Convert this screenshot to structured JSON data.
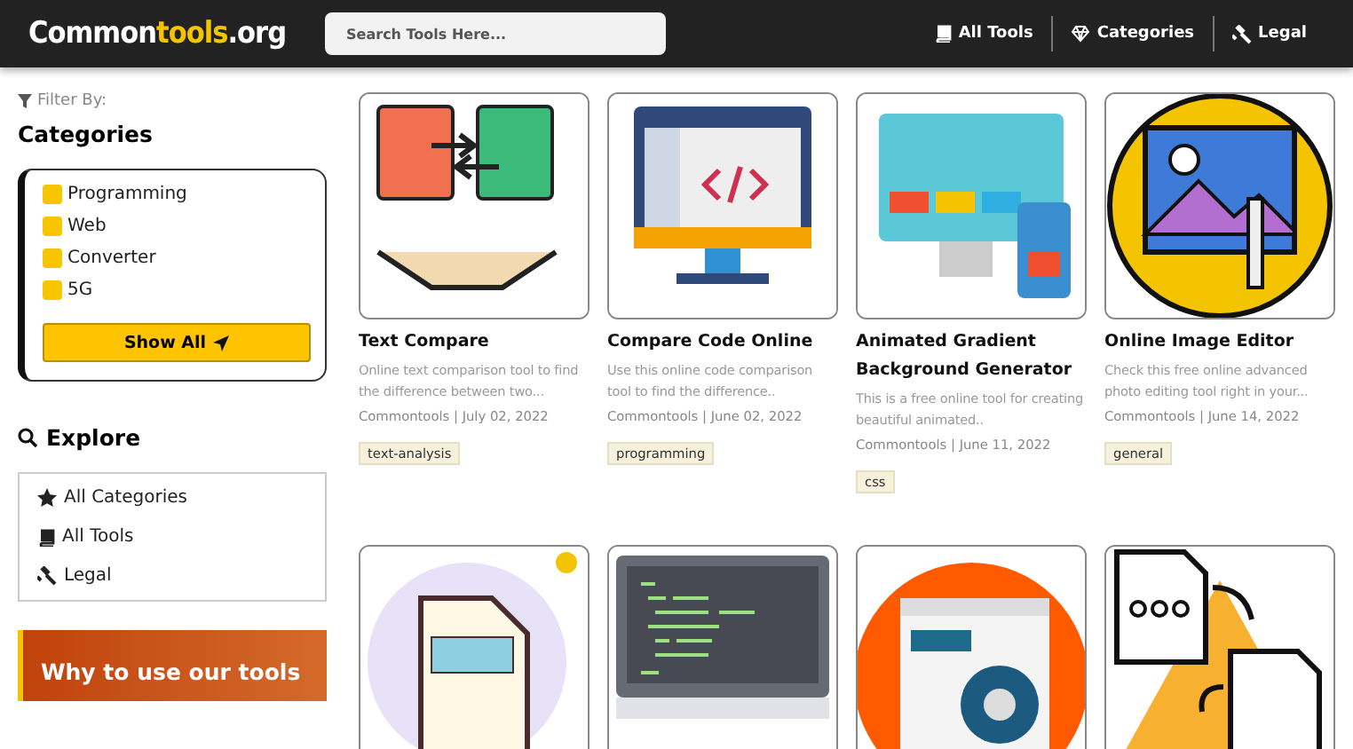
{
  "header": {
    "logo": [
      {
        "text": "Common",
        "highlight": false
      },
      {
        "text": "tools",
        "highlight": true
      },
      {
        "text": ".org",
        "highlight": false
      }
    ],
    "search": {
      "placeholder": "Search Tools Here..."
    },
    "nav": [
      {
        "label": "All Tools"
      },
      {
        "label": "Categories"
      },
      {
        "label": "Legal"
      }
    ]
  },
  "sidebar": {
    "filter_label": "Filter By:",
    "categories_title": "Categories",
    "categories": [
      {
        "label": "Programming",
        "checked": false
      },
      {
        "label": "Web",
        "checked": false
      },
      {
        "label": "Converter",
        "checked": false
      },
      {
        "label": "5G",
        "checked": false
      }
    ],
    "show_all": "Show All",
    "explore_title": "Explore",
    "explore": [
      {
        "label": "All Categories"
      },
      {
        "label": "All Tools"
      },
      {
        "label": "Legal"
      }
    ],
    "banner": "Why to use our tools"
  },
  "tools": [
    {
      "title": "Text Compare",
      "description": "Online text comparison tool to find the difference between two...",
      "meta": "Commontools | July 02, 2022",
      "tag": "text-analysis"
    },
    {
      "title": "Compare Code Online",
      "description": "Use this online code comparison tool to find the difference..",
      "meta": "Commontools | June 02, 2022",
      "tag": "programming"
    },
    {
      "title": "Animated Gradient Background Generator",
      "description": "This is a free online tool for creating beautiful animated..",
      "meta": "Commontools | June 11, 2022",
      "tag": "css"
    },
    {
      "title": "Online Image Editor",
      "description": "Check this free online advanced photo editing tool right in your...",
      "meta": "Commontools | June 14, 2022",
      "tag": "general"
    }
  ]
}
